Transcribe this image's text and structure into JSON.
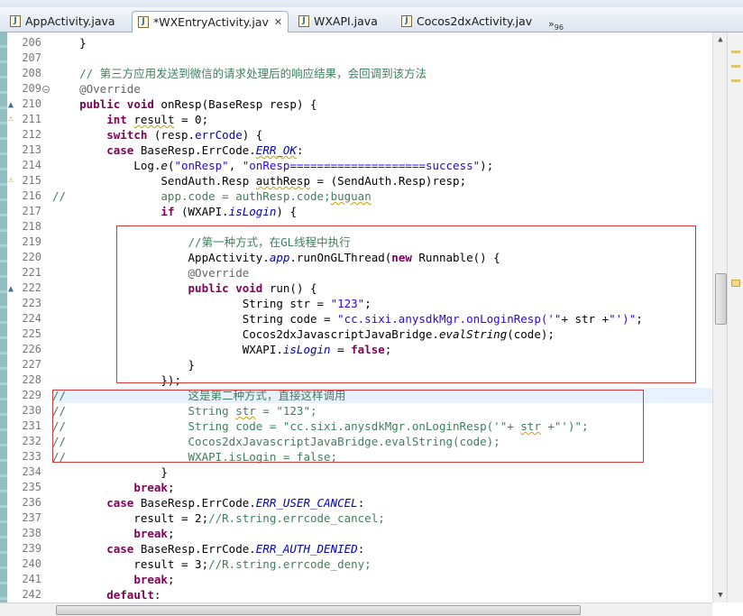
{
  "tabs": [
    {
      "label": "AppActivity.java",
      "active": false
    },
    {
      "label": "*WXEntryActivity.jav",
      "active": true,
      "closable": true
    },
    {
      "label": "WXAPI.java",
      "active": false
    },
    {
      "label": "Cocos2dxActivity.jav",
      "active": false
    }
  ],
  "tab_overflow": {
    "label": "»",
    "count": "96"
  },
  "line_numbers": [
    "206",
    "207",
    "208",
    "209",
    "210",
    "211",
    "212",
    "213",
    "214",
    "215",
    "216",
    "217",
    "218",
    "219",
    "220",
    "221",
    "222",
    "223",
    "224",
    "225",
    "226",
    "227",
    "228",
    "229",
    "230",
    "231",
    "232",
    "233",
    "234",
    "235",
    "236",
    "237",
    "238",
    "239",
    "240",
    "241",
    "242"
  ],
  "code_lines": [
    [
      {
        "t": "    }"
      }
    ],
    [
      {
        "t": ""
      }
    ],
    [
      {
        "t": "    // 第三方应用发送到微信的请求处理后的响应结果，会回调到该方法",
        "c": "cm"
      }
    ],
    [
      {
        "t": "    "
      },
      {
        "t": "@Override",
        "c": "ann"
      }
    ],
    [
      {
        "t": "    "
      },
      {
        "t": "public",
        "c": "kw"
      },
      {
        "t": " "
      },
      {
        "t": "void",
        "c": "kw"
      },
      {
        "t": " onResp(BaseResp resp) {"
      }
    ],
    [
      {
        "t": "        "
      },
      {
        "t": "int",
        "c": "kw"
      },
      {
        "t": " "
      },
      {
        "t": "result",
        "c": "warn-u"
      },
      {
        "t": " = 0;"
      }
    ],
    [
      {
        "t": "        "
      },
      {
        "t": "switch",
        "c": "kw"
      },
      {
        "t": " (resp."
      },
      {
        "t": "errCode",
        "c": "fld"
      },
      {
        "t": ") {"
      }
    ],
    [
      {
        "t": "        "
      },
      {
        "t": "case",
        "c": "kw"
      },
      {
        "t": " BaseResp.ErrCode."
      },
      {
        "t": "ERR_OK",
        "c": "fld ital warn-u"
      },
      {
        "t": ":"
      }
    ],
    [
      {
        "t": "            Log."
      },
      {
        "t": "e",
        "c": "ital"
      },
      {
        "t": "("
      },
      {
        "t": "\"onResp\"",
        "c": "str"
      },
      {
        "t": ", "
      },
      {
        "t": "\"onResp====================success\"",
        "c": "str"
      },
      {
        "t": ");"
      }
    ],
    [
      {
        "t": "                SendAuth.Resp "
      },
      {
        "t": "authResp",
        "c": "warn-u"
      },
      {
        "t": " = (SendAuth.Resp)resp;"
      }
    ],
    [
      {
        "t": "//              app.code = authResp.code;",
        "c": "cm"
      },
      {
        "t": "buguan",
        "c": "cm warn-u"
      }
    ],
    [
      {
        "t": "                "
      },
      {
        "t": "if",
        "c": "kw"
      },
      {
        "t": " (WXAPI."
      },
      {
        "t": "isLogin",
        "c": "fld ital"
      },
      {
        "t": ") {"
      }
    ],
    [
      {
        "t": ""
      }
    ],
    [
      {
        "t": "                    //第一种方式，在GL线程中执行",
        "c": "cm"
      }
    ],
    [
      {
        "t": "                    AppActivity."
      },
      {
        "t": "app",
        "c": "fld ital"
      },
      {
        "t": ".runOnGLThread("
      },
      {
        "t": "new",
        "c": "kw"
      },
      {
        "t": " Runnable() {"
      }
    ],
    [
      {
        "t": "                    "
      },
      {
        "t": "@Override",
        "c": "ann"
      }
    ],
    [
      {
        "t": "                    "
      },
      {
        "t": "public",
        "c": "kw"
      },
      {
        "t": " "
      },
      {
        "t": "void",
        "c": "kw"
      },
      {
        "t": " run() {"
      }
    ],
    [
      {
        "t": "                            String str = "
      },
      {
        "t": "\"123\"",
        "c": "str"
      },
      {
        "t": ";"
      }
    ],
    [
      {
        "t": "                            String code = "
      },
      {
        "t": "\"cc.sixi.anysdkMgr.onLoginResp('\"",
        "c": "str"
      },
      {
        "t": "+ str +"
      },
      {
        "t": "\"')\"",
        "c": "str"
      },
      {
        "t": ";"
      }
    ],
    [
      {
        "t": "                            Cocos2dxJavascriptJavaBridge."
      },
      {
        "t": "evalString",
        "c": "ital"
      },
      {
        "t": "(code);"
      }
    ],
    [
      {
        "t": "                            WXAPI."
      },
      {
        "t": "isLogin",
        "c": "fld ital"
      },
      {
        "t": " = "
      },
      {
        "t": "false",
        "c": "kw"
      },
      {
        "t": ";"
      }
    ],
    [
      {
        "t": "                    }"
      }
    ],
    [
      {
        "t": "                });"
      }
    ],
    [
      {
        "t": "//                  这是第二种方式，直接这样调用",
        "c": "cm-alt"
      }
    ],
    [
      {
        "t": "//                  String ",
        "c": "cm"
      },
      {
        "t": "str",
        "c": "cm warn-u"
      },
      {
        "t": " = \"123\";",
        "c": "cm"
      }
    ],
    [
      {
        "t": "//                  String code = \"cc.sixi.anysdkMgr.onLoginResp('\"+ ",
        "c": "cm"
      },
      {
        "t": "str",
        "c": "cm warn-u"
      },
      {
        "t": " +\"')\";",
        "c": "cm"
      }
    ],
    [
      {
        "t": "//                  Cocos2dxJavascriptJavaBridge.evalString(code);",
        "c": "cm"
      }
    ],
    [
      {
        "t": "//                  WXAPI.isLogin = false;",
        "c": "cm"
      }
    ],
    [
      {
        "t": "                }"
      }
    ],
    [
      {
        "t": "            "
      },
      {
        "t": "break",
        "c": "kw"
      },
      {
        "t": ";"
      }
    ],
    [
      {
        "t": "        "
      },
      {
        "t": "case",
        "c": "kw"
      },
      {
        "t": " BaseResp.ErrCode."
      },
      {
        "t": "ERR_USER_CANCEL",
        "c": "fld ital"
      },
      {
        "t": ":"
      }
    ],
    [
      {
        "t": "            result = 2;"
      },
      {
        "t": "//R.string.errcode_cancel;",
        "c": "cm"
      }
    ],
    [
      {
        "t": "            "
      },
      {
        "t": "break",
        "c": "kw"
      },
      {
        "t": ";"
      }
    ],
    [
      {
        "t": "        "
      },
      {
        "t": "case",
        "c": "kw"
      },
      {
        "t": " BaseResp.ErrCode."
      },
      {
        "t": "ERR_AUTH_DENIED",
        "c": "fld ital"
      },
      {
        "t": ":"
      }
    ],
    [
      {
        "t": "            result = 3;"
      },
      {
        "t": "//R.string.errcode_deny;",
        "c": "cm"
      }
    ],
    [
      {
        "t": "            "
      },
      {
        "t": "break",
        "c": "kw"
      },
      {
        "t": ";"
      }
    ],
    [
      {
        "t": "        "
      },
      {
        "t": "default",
        "c": "kw"
      },
      {
        "t": ":"
      }
    ]
  ],
  "current_line": "229",
  "colors": {
    "keyword": "#7f0055",
    "comment": "#3f7f5f",
    "string": "#2a00ff",
    "field": "#0000c0",
    "highlight_box": "#d43a3a"
  },
  "icons": {
    "tab_file": "java-file-icon",
    "close": "close-icon",
    "warning": "warning-icon",
    "override": "override-triangle-icon"
  }
}
